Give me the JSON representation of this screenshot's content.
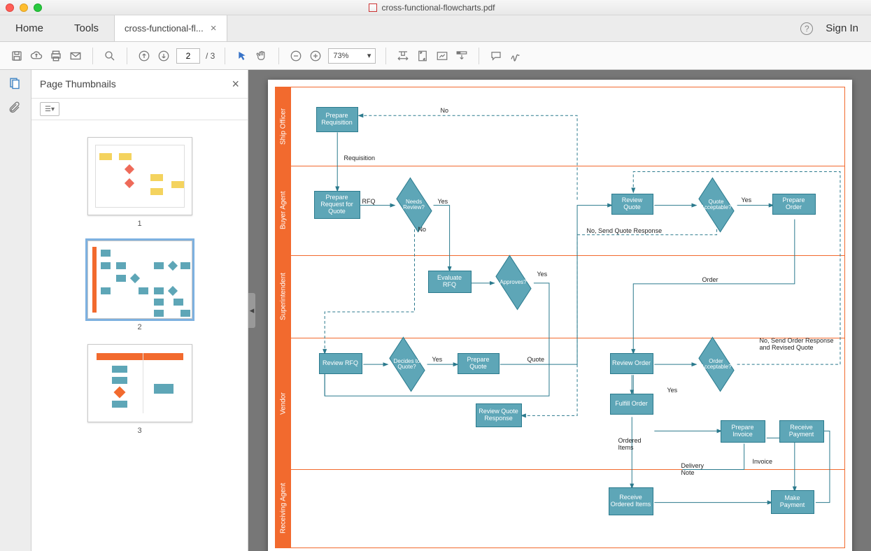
{
  "window": {
    "title": "cross-functional-flowcharts.pdf"
  },
  "tabs": {
    "home": "Home",
    "tools": "Tools",
    "doc": "cross-functional-fl...",
    "signin": "Sign In"
  },
  "toolbar": {
    "page_current": "2",
    "page_total": "/  3",
    "zoom": "73%"
  },
  "sidebar": {
    "title": "Page Thumbnails",
    "pages": [
      "1",
      "2",
      "3"
    ]
  },
  "lanes": [
    "Ship Officer",
    "Buyer Agent",
    "Superintendent",
    "Vendor",
    "Receiving Agent"
  ],
  "nodes": {
    "prepare_req": "Prepare Requisition",
    "prepare_rfq": "Prepare Request for Quote",
    "needs_review": "Needs Review?",
    "evaluate_rfq": "Evaluate RFQ",
    "approves": "Approves?",
    "review_rfq": "Review RFQ",
    "decides_quote": "Decides to Quote?",
    "prepare_quote": "Prepare Quote",
    "review_quote_resp": "Review Quote Response",
    "review_quote": "Review Quote",
    "quote_acceptable": "Quote Acceptable?",
    "prepare_order": "Prepare Order",
    "review_order": "Review Order",
    "order_acceptable": "Order Acceptable?",
    "fulfill_order": "Fulfill Order",
    "prepare_invoice": "Prepare Invoice",
    "receive_payment": "Receive Payment",
    "receive_items": "Receive Ordered Items",
    "make_payment": "Make Payment"
  },
  "edges": {
    "requisition": "Requisition",
    "rfq": "RFQ",
    "yes1": "Yes",
    "no1": "No",
    "no_top": "No",
    "yes2": "Yes",
    "yes3": "Yes",
    "quote": "Quote",
    "no_send_qr": "No, Send Quote Response",
    "order": "Order",
    "yes4": "Yes",
    "no_send_or": "No,\nSend Order Response\nand Revised Quote",
    "yes5": "Yes",
    "ordered_items": "Ordered Items",
    "delivery_note": "Delivery Note",
    "invoice": "Invoice"
  }
}
